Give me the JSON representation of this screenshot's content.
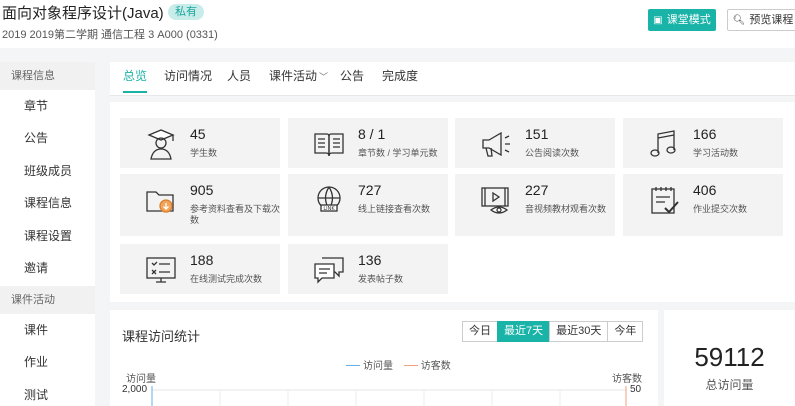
{
  "header": {
    "title": "面向对象程序设计(Java)",
    "badge": "私有",
    "subtitle": "2019 2019第二学期 通信工程 3 A000 (0331)",
    "class_mode_label": "课堂模式",
    "preview_label": "预览课程"
  },
  "sidebar": {
    "group_course_info": "课程信息",
    "items": [
      "章节",
      "公告",
      "班级成员",
      "课程信息",
      "课程设置",
      "邀请"
    ],
    "group_activities": "课件活动",
    "activity_items": [
      "课件",
      "作业",
      "测试"
    ]
  },
  "tabs": [
    "总览",
    "访问情况",
    "人员",
    "课件活动",
    "公告",
    "完成度"
  ],
  "stats": [
    {
      "value": "45",
      "label": "学生数",
      "icon": "graduate-icon"
    },
    {
      "value": "8 / 1",
      "label": "章节数 / 学习单元数",
      "icon": "book-icon"
    },
    {
      "value": "151",
      "label": "公告阅读次数",
      "icon": "megaphone-icon"
    },
    {
      "value": "166",
      "label": "学习活动数",
      "icon": "music-note-icon"
    },
    {
      "value": "905",
      "label": "参考资料查看及下载次数",
      "icon": "folder-download-icon"
    },
    {
      "value": "727",
      "label": "线上链接查看次数",
      "icon": "globe-link-icon"
    },
    {
      "value": "227",
      "label": "音视频教材观看次数",
      "icon": "video-eye-icon"
    },
    {
      "value": "406",
      "label": "作业提交次数",
      "icon": "clipboard-check-icon"
    },
    {
      "value": "188",
      "label": "在线测试完成次数",
      "icon": "screen-test-icon"
    },
    {
      "value": "136",
      "label": "发表帖子数",
      "icon": "chat-icon"
    }
  ],
  "chart": {
    "title": "课程访问统计",
    "ranges": [
      "今日",
      "最近7天",
      "最近30天",
      "今年"
    ],
    "active_range": "最近7天",
    "legend_visits": "访问量",
    "legend_visitors": "访客数",
    "y_left_label": "访问量",
    "y_right_label": "访客数",
    "y_left_top": "2,000",
    "y_right_top": "50",
    "visits_color": "#6ab0e8",
    "visitors_color": "#f2a07b"
  },
  "total": {
    "value": "59112",
    "label": "总访问量"
  },
  "colors": {
    "accent": "#1ab3a8"
  }
}
